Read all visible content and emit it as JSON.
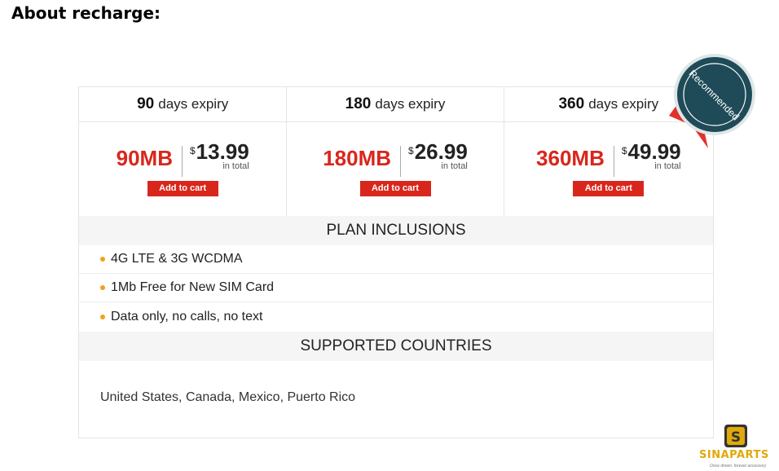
{
  "page": {
    "heading": "About recharge:"
  },
  "plans": [
    {
      "days": "90",
      "days_label": "days expiry",
      "data": "90MB",
      "currency": "$",
      "price": "13.99",
      "total_label": "in total",
      "cart_label": "Add to cart"
    },
    {
      "days": "180",
      "days_label": "days expiry",
      "data": "180MB",
      "currency": "$",
      "price": "26.99",
      "total_label": "in total",
      "cart_label": "Add to cart"
    },
    {
      "days": "360",
      "days_label": "days expiry",
      "data": "360MB",
      "currency": "$",
      "price": "49.99",
      "total_label": "in total",
      "cart_label": "Add to cart"
    }
  ],
  "badge": {
    "text": "Recommended",
    "circle_color": "#1f4b59",
    "ribbon_color": "#e0322b"
  },
  "inclusions": {
    "title": "PLAN INCLUSIONS",
    "items": [
      "4G LTE & 3G WCDMA",
      "1Mb Free for New SIM Card",
      "Data only, no calls, no text"
    ]
  },
  "countries": {
    "title": "SUPPORTED COUNTRIES",
    "text": "United States, Canada, Mexico, Puerto Rico"
  },
  "logo": {
    "letter": "S",
    "name": "SINAPARTS",
    "tagline": "Once driven. forever accessory"
  },
  "colors": {
    "accent": "#d9261c",
    "bullet": "#f0a21d",
    "logo": "#e0a90a"
  }
}
